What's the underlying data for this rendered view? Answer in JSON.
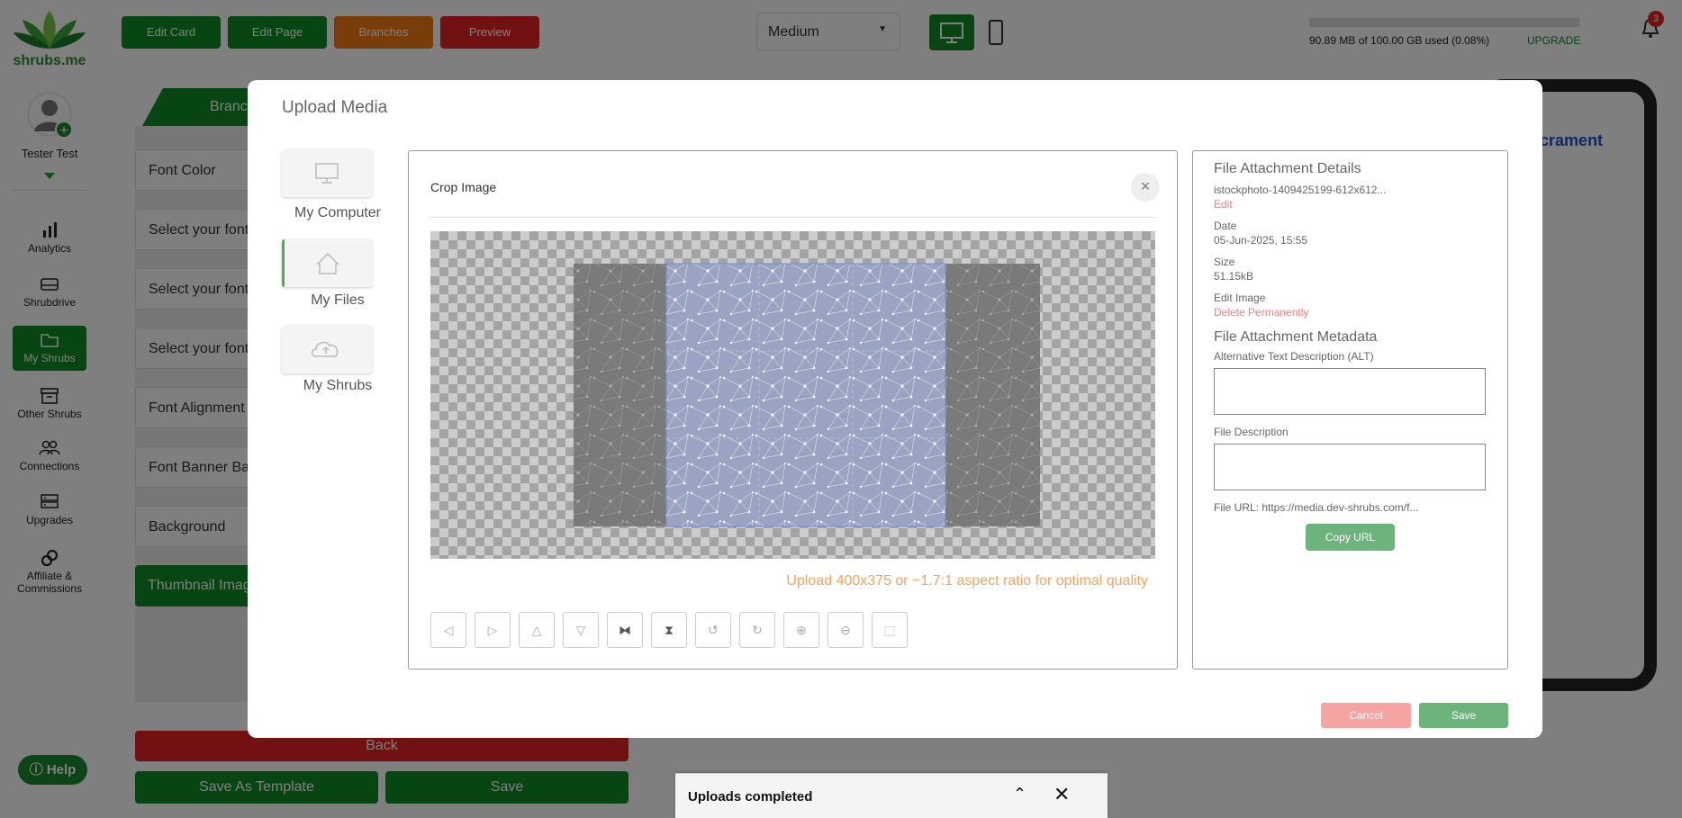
{
  "brand": {
    "name": "shrubs.me",
    "accent": "#0e8a27"
  },
  "sidebar": {
    "user_name": "Tester Test",
    "items": [
      {
        "label": "Analytics",
        "icon": "bar-chart-icon"
      },
      {
        "label": "Shrubdrive",
        "icon": "drive-icon"
      },
      {
        "label": "My Shrubs",
        "icon": "folder-icon"
      },
      {
        "label": "Other Shrubs",
        "icon": "archive-icon"
      },
      {
        "label": "Connections",
        "icon": "people-icon"
      },
      {
        "label": "Upgrades",
        "icon": "server-icon"
      },
      {
        "label": "Affiliate & Commissions",
        "icon": "link-icon"
      }
    ],
    "help_label": "Help"
  },
  "topbar": {
    "edit_card": "Edit Card",
    "edit_page": "Edit Page",
    "branches": "Branches",
    "preview": "Preview",
    "size_select": "Medium",
    "storage_text": "90.89 MB of 100.00 GB used (0.08%)",
    "storage_fraction": 0.0008,
    "upgrade": "UPGRADE",
    "notifications": "3"
  },
  "background_editor": {
    "tab": "Branc",
    "rows": [
      "Font Color",
      "Select your font",
      "Select your font",
      "Select your font",
      "Font Alignment",
      "Font Banner Ba",
      "Background",
      "Thumbnail Image"
    ],
    "back": "Back",
    "save_template": "Save As Template",
    "save": "Save",
    "preview_text": "sacrament"
  },
  "modal": {
    "title": "Upload Media",
    "sources": [
      "My Computer",
      "My Files",
      "My Shrubs"
    ],
    "crop": {
      "title": "Crop Image",
      "hint": "Upload 400x375 or ~1.7:1 aspect ratio for optimal quality"
    },
    "details": {
      "heading": "File Attachment Details",
      "filename": "istockphoto-1409425199-612x612...",
      "edit": "Edit",
      "date_label": "Date",
      "date_value": "05-Jun-2025, 15:55",
      "size_label": "Size",
      "size_value": "51.15kB",
      "edit_image": "Edit Image",
      "delete": "Delete Permanently",
      "meta_heading": "File Attachment Metadata",
      "alt_label": "Alternative Text Description (ALT)",
      "desc_label": "File Description",
      "url": "File URL: https://media.dev-shrubs.com/f...",
      "copy_url": "Copy URL"
    },
    "cancel": "Cancel",
    "save": "Save"
  },
  "toast": {
    "text": "Uploads completed"
  }
}
